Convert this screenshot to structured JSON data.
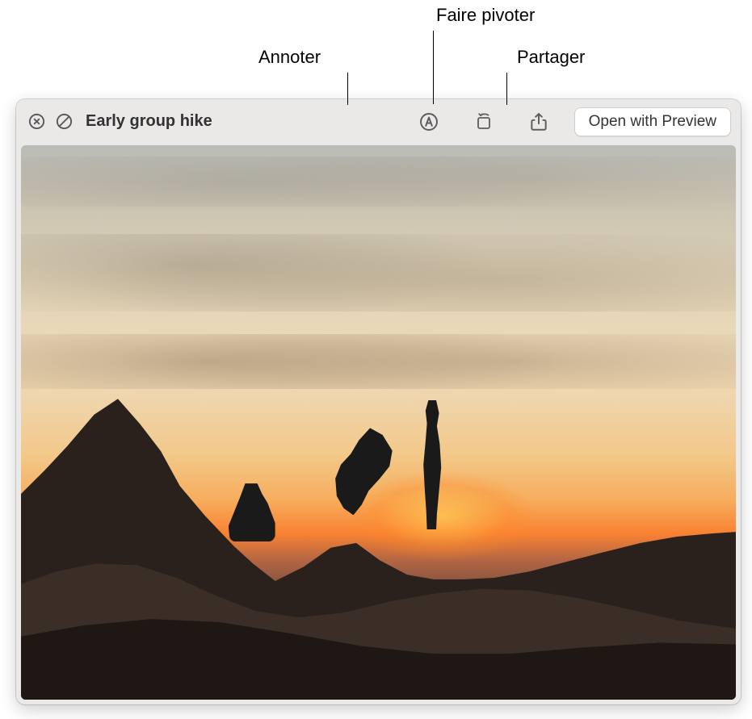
{
  "callouts": {
    "annotate": "Annoter",
    "rotate": "Faire pivoter",
    "share": "Partager"
  },
  "window": {
    "title": "Early group hike",
    "open_button": "Open with Preview"
  },
  "icons": {
    "close": "close-icon",
    "skip": "skip-icon",
    "markup": "markup-icon",
    "rotate": "rotate-icon",
    "share": "share-icon"
  }
}
